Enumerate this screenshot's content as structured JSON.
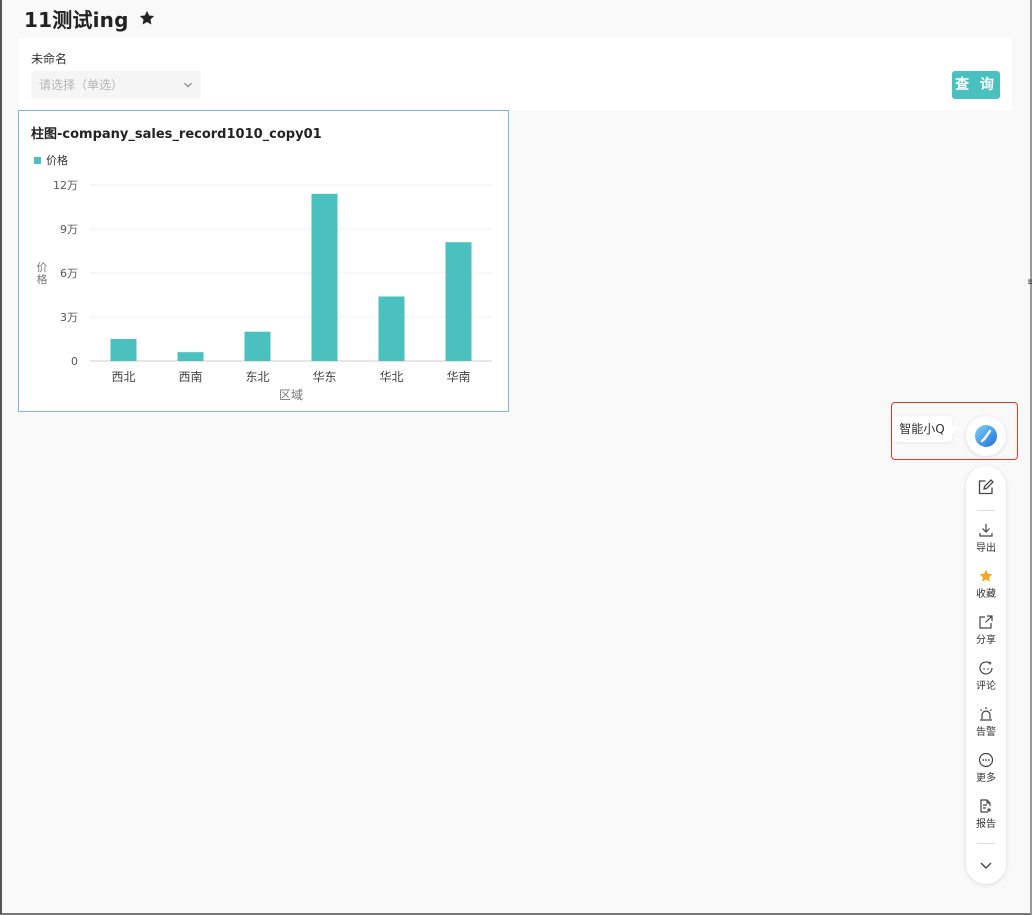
{
  "page": {
    "title": "11测试ing"
  },
  "filter": {
    "label": "未命名",
    "placeholder": "请选择（单选）",
    "query_button": "查 询"
  },
  "chart_data": {
    "type": "bar",
    "title": "柱图-company_sales_record1010_copy01",
    "series": [
      {
        "name": "价格",
        "values": [
          15000,
          6000,
          20000,
          114000,
          44000,
          81000
        ]
      }
    ],
    "categories": [
      "西北",
      "西南",
      "东北",
      "华东",
      "华北",
      "华南"
    ],
    "ytick_labels": [
      "0",
      "3万",
      "6万",
      "9万",
      "12万"
    ],
    "yticks": [
      0,
      30000,
      60000,
      90000,
      120000
    ],
    "ylim": [
      0,
      120000
    ],
    "xlabel": "区域",
    "ylabel": "价格",
    "legend_position": "top-left",
    "grid": true,
    "color": "#4ac1bf"
  },
  "assistant": {
    "label": "智能小Q"
  },
  "toolbar": {
    "items": [
      {
        "icon": "edit-icon",
        "label": ""
      },
      {
        "icon": "download-icon",
        "label": "导出"
      },
      {
        "icon": "star-icon",
        "label": "收藏"
      },
      {
        "icon": "share-icon",
        "label": "分享"
      },
      {
        "icon": "comment-icon",
        "label": "评论"
      },
      {
        "icon": "alarm-icon",
        "label": "告警"
      },
      {
        "icon": "more-icon",
        "label": "更多"
      },
      {
        "icon": "report-icon",
        "label": "报告"
      },
      {
        "icon": "chevron-down-icon",
        "label": ""
      }
    ]
  },
  "colors": {
    "accent": "#4ac1bf",
    "favorite": "#f5a623",
    "highlight_border": "#e03a2b",
    "chart_border": "#7cb4ea"
  }
}
